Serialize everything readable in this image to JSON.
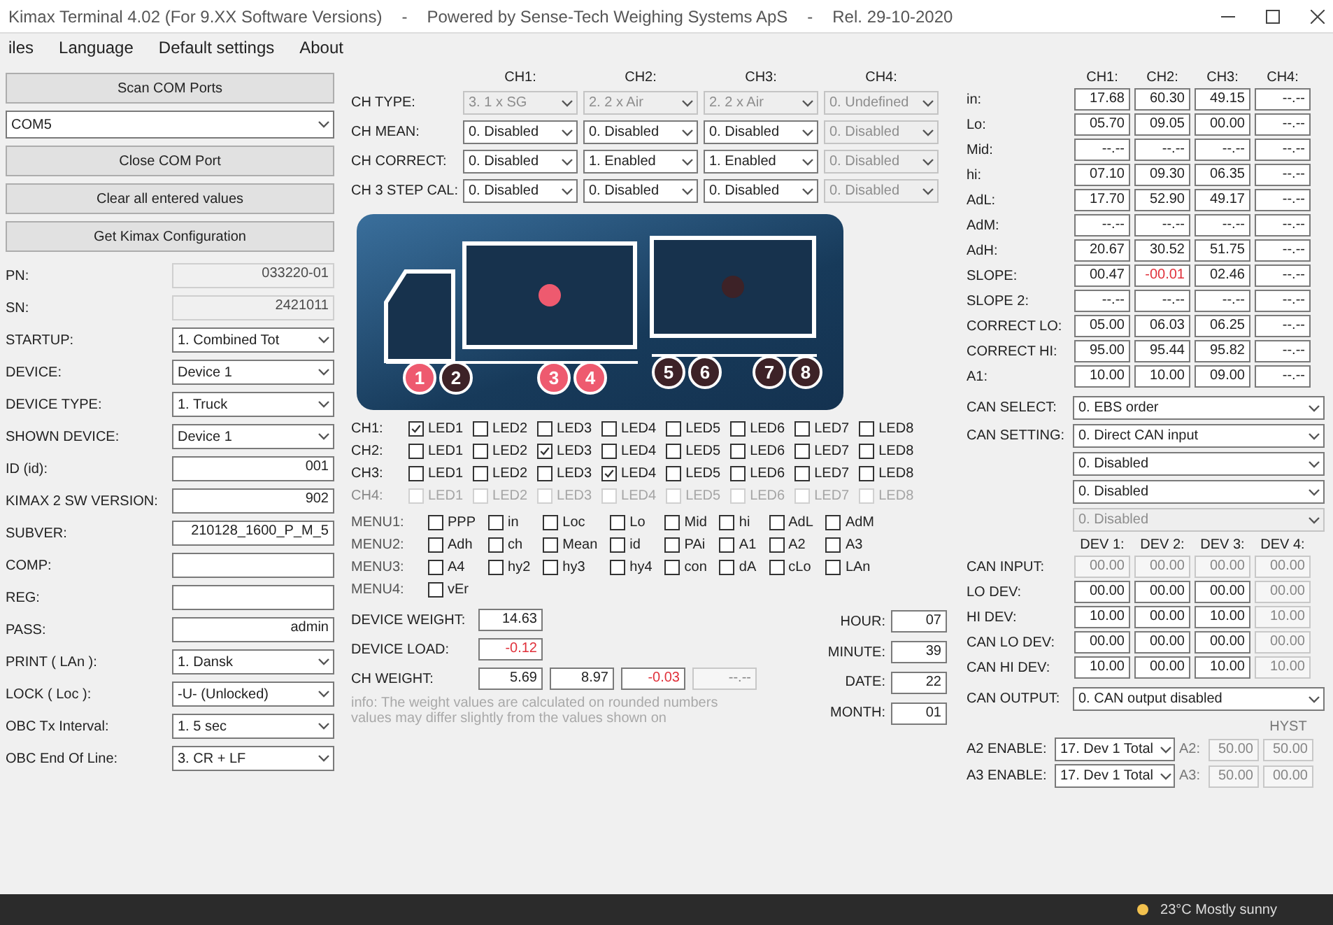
{
  "window": {
    "title_parts": [
      "Kimax Terminal 4.02 (For 9.XX Software Versions)",
      "-",
      "Powered by Sense-Tech Weighing Systems ApS",
      "-",
      "Rel. 29-10-2020"
    ]
  },
  "menu": [
    "iles",
    "Language",
    "Default settings",
    "About"
  ],
  "connection": [
    {
      "kind": "button",
      "label": "Scan COM Ports"
    },
    {
      "kind": "select",
      "value": "COM5"
    },
    {
      "kind": "button",
      "label": "Close COM Port"
    },
    {
      "kind": "button",
      "label": "Clear all entered values"
    },
    {
      "kind": "button",
      "label": "Get Kimax Configuration"
    }
  ],
  "device_fields": [
    {
      "kind": "text",
      "label": "PN:",
      "value": "033220-01",
      "readonly": true
    },
    {
      "kind": "text",
      "label": "SN:",
      "value": "2421011",
      "readonly": true
    },
    {
      "kind": "select",
      "label": "STARTUP:",
      "value": "1. Combined Tot"
    },
    {
      "kind": "select",
      "label": "DEVICE:",
      "value": "Device 1"
    },
    {
      "kind": "select",
      "label": "DEVICE TYPE:",
      "value": "1. Truck"
    },
    {
      "kind": "select",
      "label": "SHOWN DEVICE:",
      "value": "Device 1"
    },
    {
      "kind": "text",
      "label": "ID (id):",
      "value": "001",
      "readonly": false
    },
    {
      "kind": "text",
      "label": "KIMAX 2 SW VERSION:",
      "value": "902",
      "readonly": false
    },
    {
      "kind": "text",
      "label": "SUBVER:",
      "value": "210128_1600_P_M_5",
      "readonly": false
    },
    {
      "kind": "text",
      "label": "COMP:",
      "readonly": false
    },
    {
      "kind": "text",
      "label": "REG:",
      "readonly": false
    },
    {
      "kind": "text",
      "label": "PASS:",
      "value": "admin",
      "readonly": false
    },
    {
      "kind": "select",
      "label": "PRINT ( LAn ):",
      "value": "1. Dansk"
    },
    {
      "kind": "select",
      "label": "LOCK ( Loc ):",
      "value": "-U- (Unlocked)"
    },
    {
      "kind": "select",
      "label": "OBC Tx Interval:",
      "value": "1.  5 sec"
    },
    {
      "kind": "select",
      "label": "OBC End Of Line:",
      "value": "3. CR + LF"
    }
  ],
  "channels": {
    "headers": [
      "CH1:",
      "CH2:",
      "CH3:",
      "CH4:"
    ],
    "rows": [
      {
        "label": "CH TYPE:",
        "options": [
          {
            "value": "3. 1 x SG",
            "disabled": true
          },
          {
            "value": "2. 2 x Air",
            "disabled": true
          },
          {
            "value": "2. 2 x Air",
            "disabled": true
          },
          {
            "value": "0. Undefined",
            "disabled": true
          }
        ]
      },
      {
        "label": "CH MEAN:",
        "options": [
          {
            "value": "0. Disabled",
            "disabled": false
          },
          {
            "value": "0. Disabled",
            "disabled": false
          },
          {
            "value": "0. Disabled",
            "disabled": false
          },
          {
            "value": "0. Disabled",
            "disabled": true
          }
        ]
      },
      {
        "label": "CH CORRECT:",
        "options": [
          {
            "value": "0. Disabled",
            "disabled": false
          },
          {
            "value": "1. Enabled",
            "disabled": false
          },
          {
            "value": "1. Enabled",
            "disabled": false
          },
          {
            "value": "0. Disabled",
            "disabled": true
          }
        ]
      },
      {
        "label": "CH 3 STEP CAL:",
        "options": [
          {
            "value": "0. Disabled",
            "disabled": false
          },
          {
            "value": "0. Disabled",
            "disabled": false
          },
          {
            "value": "0. Disabled",
            "disabled": false
          },
          {
            "value": "0. Disabled",
            "disabled": true
          }
        ]
      }
    ]
  },
  "vehicle": {
    "truck_light": {
      "on": true
    },
    "trailer_light": {
      "on": false
    },
    "wheels": [
      {
        "label": "1",
        "active": true
      },
      {
        "label": "2",
        "active": false
      },
      {
        "label": "3",
        "active": true
      },
      {
        "label": "4",
        "active": true
      },
      {
        "label": "5",
        "active": false
      },
      {
        "label": "6",
        "active": false
      },
      {
        "label": "7",
        "active": false
      },
      {
        "label": "8",
        "active": false
      }
    ]
  },
  "leds": [
    {
      "label": "CH1:",
      "disabled": false,
      "items": [
        {
          "label": "LED1",
          "checked": true
        },
        {
          "label": "LED2",
          "checked": false
        },
        {
          "label": "LED3",
          "checked": false
        },
        {
          "label": "LED4",
          "checked": false
        },
        {
          "label": "LED5",
          "checked": false
        },
        {
          "label": "LED6",
          "checked": false
        },
        {
          "label": "LED7",
          "checked": false
        },
        {
          "label": "LED8",
          "checked": false
        }
      ]
    },
    {
      "label": "CH2:",
      "disabled": false,
      "items": [
        {
          "label": "LED1",
          "checked": false
        },
        {
          "label": "LED2",
          "checked": false
        },
        {
          "label": "LED3",
          "checked": true
        },
        {
          "label": "LED4",
          "checked": false
        },
        {
          "label": "LED5",
          "checked": false
        },
        {
          "label": "LED6",
          "checked": false
        },
        {
          "label": "LED7",
          "checked": false
        },
        {
          "label": "LED8",
          "checked": false
        }
      ]
    },
    {
      "label": "CH3:",
      "disabled": false,
      "items": [
        {
          "label": "LED1",
          "checked": false
        },
        {
          "label": "LED2",
          "checked": false
        },
        {
          "label": "LED3",
          "checked": false
        },
        {
          "label": "LED4",
          "checked": true
        },
        {
          "label": "LED5",
          "checked": false
        },
        {
          "label": "LED6",
          "checked": false
        },
        {
          "label": "LED7",
          "checked": false
        },
        {
          "label": "LED8",
          "checked": false
        }
      ]
    },
    {
      "label": "CH4:",
      "disabled": true,
      "items": [
        {
          "label": "LED1",
          "checked": false
        },
        {
          "label": "LED2",
          "checked": false
        },
        {
          "label": "LED3",
          "checked": false
        },
        {
          "label": "LED4",
          "checked": false
        },
        {
          "label": "LED5",
          "checked": false
        },
        {
          "label": "LED6",
          "checked": false
        },
        {
          "label": "LED7",
          "checked": false
        },
        {
          "label": "LED8",
          "checked": false
        }
      ]
    }
  ],
  "menus": [
    {
      "label": "MENU1:",
      "items": [
        {
          "label": "PPP",
          "checked": false
        },
        {
          "label": "in",
          "checked": false
        },
        {
          "label": "Loc",
          "checked": false
        },
        {
          "label": "Lo",
          "checked": false
        },
        {
          "label": "Mid",
          "checked": false
        },
        {
          "label": "hi",
          "checked": false
        },
        {
          "label": "AdL",
          "checked": false
        },
        {
          "label": "AdM",
          "checked": false
        }
      ]
    },
    {
      "label": "MENU2:",
      "items": [
        {
          "label": "Adh",
          "checked": false
        },
        {
          "label": "ch",
          "checked": false
        },
        {
          "label": "Mean",
          "checked": false
        },
        {
          "label": "id",
          "checked": false
        },
        {
          "label": "PAi",
          "checked": false
        },
        {
          "label": "A1",
          "checked": false
        },
        {
          "label": "A2",
          "checked": false
        },
        {
          "label": "A3",
          "checked": false
        }
      ]
    },
    {
      "label": "MENU3:",
      "items": [
        {
          "label": "A4",
          "checked": false
        },
        {
          "label": "hy2",
          "checked": false
        },
        {
          "label": "hy3",
          "checked": false
        },
        {
          "label": "hy4",
          "checked": false
        },
        {
          "label": "con",
          "checked": false
        },
        {
          "label": "dA",
          "checked": false
        },
        {
          "label": "cLo",
          "checked": false
        },
        {
          "label": "LAn",
          "checked": false
        }
      ]
    },
    {
      "label": "MENU4:",
      "items": [
        {
          "label": "vEr",
          "checked": false
        }
      ]
    }
  ],
  "weights": {
    "rows": [
      {
        "label": "DEVICE WEIGHT:",
        "values": [
          {
            "value": "14.63",
            "alert": false,
            "disabled": false
          }
        ]
      },
      {
        "label": "DEVICE LOAD:",
        "values": [
          {
            "value": "-0.12",
            "alert": true,
            "disabled": false
          }
        ]
      },
      {
        "label": "CH WEIGHT:",
        "values": [
          {
            "value": "5.69",
            "alert": false,
            "disabled": false
          },
          {
            "value": "8.97",
            "alert": false,
            "disabled": false
          },
          {
            "value": "-0.03",
            "alert": true,
            "disabled": false
          },
          {
            "value": "--.--",
            "alert": false,
            "disabled": true
          }
        ]
      }
    ],
    "info": [
      "info: The weight values are calculated on rounded numbers",
      "values may differ slightly from the values shown on"
    ]
  },
  "clock": [
    {
      "label": "HOUR:",
      "value": "07"
    },
    {
      "label": "MINUTE:",
      "value": "39"
    },
    {
      "label": "DATE:",
      "value": "22"
    },
    {
      "label": "MONTH:",
      "value": "01"
    }
  ],
  "readings": {
    "headers": [
      "CH1:",
      "CH2:",
      "CH3:",
      "CH4:"
    ],
    "rows": [
      {
        "label": "in:",
        "values": [
          "17.68",
          "60.30",
          "49.15",
          "--.--"
        ],
        "alert": [
          false,
          false,
          false,
          false
        ]
      },
      {
        "label": "Lo:",
        "values": [
          "05.70",
          "09.05",
          "00.00",
          "--.--"
        ],
        "alert": [
          false,
          false,
          false,
          false
        ]
      },
      {
        "label": "Mid:",
        "values": [
          "--.--",
          "--.--",
          "--.--",
          "--.--"
        ],
        "alert": [
          false,
          false,
          false,
          false
        ]
      },
      {
        "label": "hi:",
        "values": [
          "07.10",
          "09.30",
          "06.35",
          "--.--"
        ],
        "alert": [
          false,
          false,
          false,
          false
        ]
      },
      {
        "label": "AdL:",
        "values": [
          "17.70",
          "52.90",
          "49.17",
          "--.--"
        ],
        "alert": [
          false,
          false,
          false,
          false
        ]
      },
      {
        "label": "AdM:",
        "values": [
          "--.--",
          "--.--",
          "--.--",
          "--.--"
        ],
        "alert": [
          false,
          false,
          false,
          false
        ]
      },
      {
        "label": "AdH:",
        "values": [
          "20.67",
          "30.52",
          "51.75",
          "--.--"
        ],
        "alert": [
          false,
          false,
          false,
          false
        ]
      },
      {
        "label": "SLOPE:",
        "values": [
          "00.47",
          "-00.01",
          "02.46",
          "--.--"
        ],
        "alert": [
          false,
          true,
          false,
          false
        ]
      },
      {
        "label": "SLOPE 2:",
        "values": [
          "--.--",
          "--.--",
          "--.--",
          "--.--"
        ],
        "alert": [
          false,
          false,
          false,
          false
        ]
      },
      {
        "label": "CORRECT LO:",
        "values": [
          "05.00",
          "06.03",
          "06.25",
          "--.--"
        ],
        "alert": [
          false,
          false,
          false,
          false
        ]
      },
      {
        "label": "CORRECT HI:",
        "values": [
          "95.00",
          "95.44",
          "95.82",
          "--.--"
        ],
        "alert": [
          false,
          false,
          false,
          false
        ]
      },
      {
        "label": "A1:",
        "values": [
          "10.00",
          "10.00",
          "09.00",
          "--.--"
        ],
        "alert": [
          false,
          false,
          false,
          false
        ]
      }
    ]
  },
  "can": {
    "selects": [
      {
        "label": "CAN SELECT:",
        "value": "0. EBS order",
        "disabled": false
      },
      {
        "label": "CAN SETTING:",
        "value": "0. Direct CAN input",
        "disabled": false
      },
      {
        "value": "0. Disabled",
        "disabled": false
      },
      {
        "value": "0. Disabled",
        "disabled": false
      },
      {
        "value": "0. Disabled",
        "disabled": true
      }
    ],
    "dev_headers": [
      "DEV 1:",
      "DEV 2:",
      "DEV 3:",
      "DEV 4:"
    ],
    "dev_rows": [
      {
        "label": "CAN INPUT:",
        "values": [
          "00.00",
          "00.00",
          "00.00",
          "00.00"
        ],
        "disabled": [
          true,
          true,
          true,
          true
        ]
      },
      {
        "label": "LO DEV:",
        "values": [
          "00.00",
          "00.00",
          "00.00",
          "00.00"
        ],
        "disabled": [
          false,
          false,
          false,
          true
        ]
      },
      {
        "label": "HI DEV:",
        "values": [
          "10.00",
          "00.00",
          "10.00",
          "10.00"
        ],
        "disabled": [
          false,
          false,
          false,
          true
        ]
      },
      {
        "label": "CAN LO DEV:",
        "values": [
          "00.00",
          "00.00",
          "00.00",
          "00.00"
        ],
        "disabled": [
          false,
          false,
          false,
          true
        ]
      },
      {
        "label": "CAN HI DEV:",
        "values": [
          "10.00",
          "00.00",
          "10.00",
          "10.00"
        ],
        "disabled": [
          false,
          false,
          false,
          true
        ]
      }
    ],
    "output": {
      "label": "CAN OUTPUT:",
      "value": "0. CAN output disabled"
    }
  },
  "alarms": {
    "hyst_header": "HYST",
    "rows": [
      {
        "label": "A2 ENABLE:",
        "value": "17. Dev 1 Total",
        "limit_label": "A2:",
        "limit": "50.00",
        "hyst": "50.00"
      },
      {
        "label": "A3 ENABLE:",
        "value": "17. Dev 1 Total",
        "limit_label": "A3:",
        "limit": "50.00",
        "hyst": "00.00"
      }
    ]
  },
  "taskbar": {
    "weather": "23°C  Mostly sunny"
  }
}
